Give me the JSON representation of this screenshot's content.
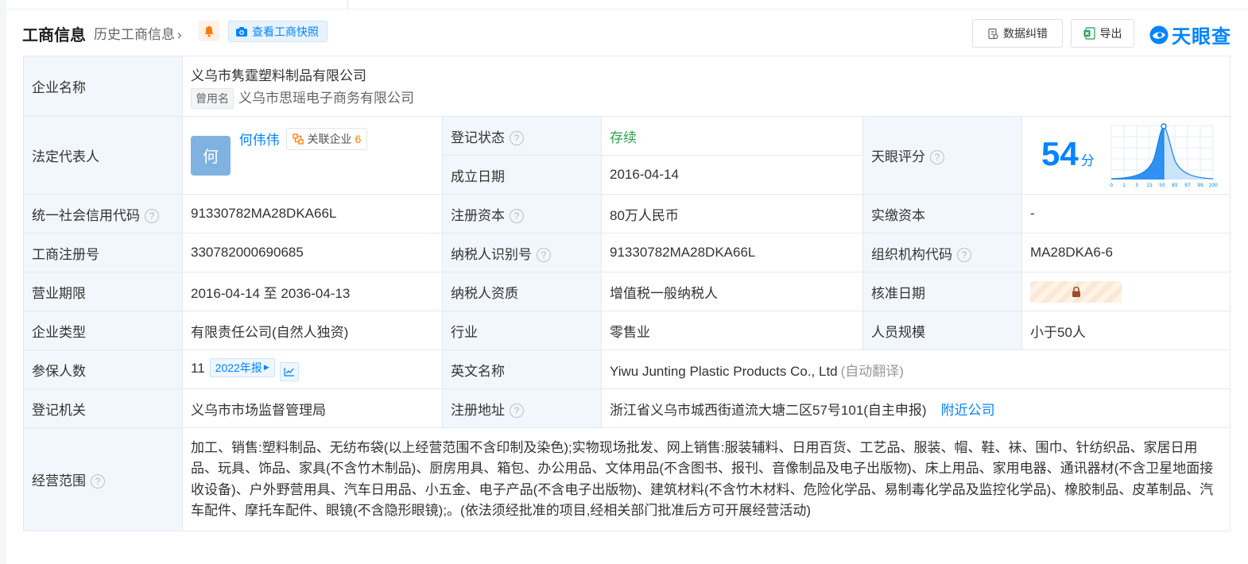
{
  "header": {
    "title": "工商信息",
    "history_link": "历史工商信息",
    "snapshot_label": "查看工商快照",
    "correct_label": "数据纠错",
    "export_label": "导出",
    "logo_text": "天眼查"
  },
  "company": {
    "name_label": "企业名称",
    "name": "义乌市隽霆塑料制品有限公司",
    "used_name_tag": "曾用名",
    "used_name": "义乌市思瑶电子商务有限公司"
  },
  "rows": {
    "legal_rep_label": "法定代表人",
    "legal_rep_avatar": "何",
    "legal_rep_name": "何伟伟",
    "assoc_label": "关联企业",
    "assoc_count": "6",
    "reg_status_label": "登记状态",
    "reg_status": "存续",
    "founded_label": "成立日期",
    "founded": "2016-04-14",
    "tianyan_score_label": "天眼评分",
    "score": "54",
    "score_unit": "分",
    "credit_code_label": "统一社会信用代码",
    "credit_code": "91330782MA28DKA66L",
    "reg_capital_label": "注册资本",
    "reg_capital": "80万人民币",
    "paid_capital_label": "实缴资本",
    "paid_capital": "-",
    "reg_no_label": "工商注册号",
    "reg_no": "330782000690685",
    "taxpayer_id_label": "纳税人识别号",
    "taxpayer_id": "91330782MA28DKA66L",
    "org_code_label": "组织机构代码",
    "org_code": "MA28DKA6-6",
    "term_label": "营业期限",
    "term": "2016-04-14 至 2036-04-13",
    "taxpayer_qual_label": "纳税人资质",
    "taxpayer_qual": "增值税一般纳税人",
    "approval_date_label": "核准日期",
    "type_label": "企业类型",
    "type": "有限责任公司(自然人独资)",
    "industry_label": "行业",
    "industry": "零售业",
    "staff_label": "人员规模",
    "staff": "小于50人",
    "insured_label": "参保人数",
    "insured": "11",
    "insured_year": "2022年报",
    "english_name_label": "英文名称",
    "english_name": "Yiwu Junting Plastic Products Co., Ltd",
    "auto_translate": "(自动翻译)",
    "authority_label": "登记机关",
    "authority": "义乌市市场监督管理局",
    "address_label": "注册地址",
    "address": "浙江省义乌市城西街道流大塘二区57号101(自主申报)",
    "nearby_link": "附近公司",
    "scope_label": "经营范围",
    "scope": "加工、销售:塑料制品、无纺布袋(以上经营范围不含印制及染色);实物现场批发、网上销售:服装辅料、日用百货、工艺品、服装、帽、鞋、袜、围巾、针纺织品、家居日用品、玩具、饰品、家具(不含竹木制品)、厨房用具、箱包、办公用品、文体用品(不含图书、报刊、音像制品及电子出版物)、床上用品、家用电器、通讯器材(不含卫星地面接收设备)、户外野营用具、汽车日用品、小五金、电子产品(不含电子出版物)、建筑材料(不含竹木材料、危险化学品、易制毒化学品及监控化学品)、橡胶制品、皮革制品、汽车配件、摩托车配件、眼镜(不含隐形眼镜);。(依法须经批准的项目,经相关部门批准后方可开展经营活动)"
  },
  "score_chart": {
    "x_ticks": [
      "0",
      "1",
      "3",
      "15",
      "50",
      "85",
      "97",
      "99",
      "100"
    ]
  },
  "colors": {
    "accent": "#0084ff",
    "status_green": "#2fa54a",
    "label_bg": "#f2f7fd"
  }
}
